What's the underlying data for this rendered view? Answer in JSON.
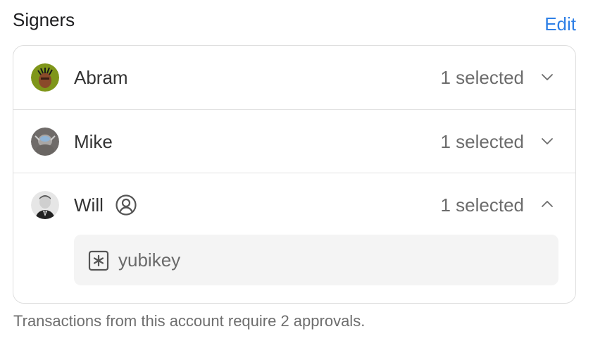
{
  "section": {
    "title": "Signers",
    "edit_label": "Edit"
  },
  "signers": [
    {
      "name": "Abram",
      "selection": "1 selected",
      "expanded": false,
      "avatar": "avatar-abram"
    },
    {
      "name": "Mike",
      "selection": "1 selected",
      "expanded": false,
      "avatar": "avatar-mike"
    },
    {
      "name": "Will",
      "selection": "1 selected",
      "expanded": true,
      "avatar": "avatar-will",
      "badge_icon": "person-circle-icon",
      "keys": [
        {
          "label": "yubikey",
          "icon": "asterisk-key-icon"
        }
      ]
    }
  ],
  "footnote": "Transactions from this account require 2 approvals.",
  "colors": {
    "accent": "#2f80e6",
    "border": "#dedede",
    "key_background": "#f4f4f4"
  }
}
